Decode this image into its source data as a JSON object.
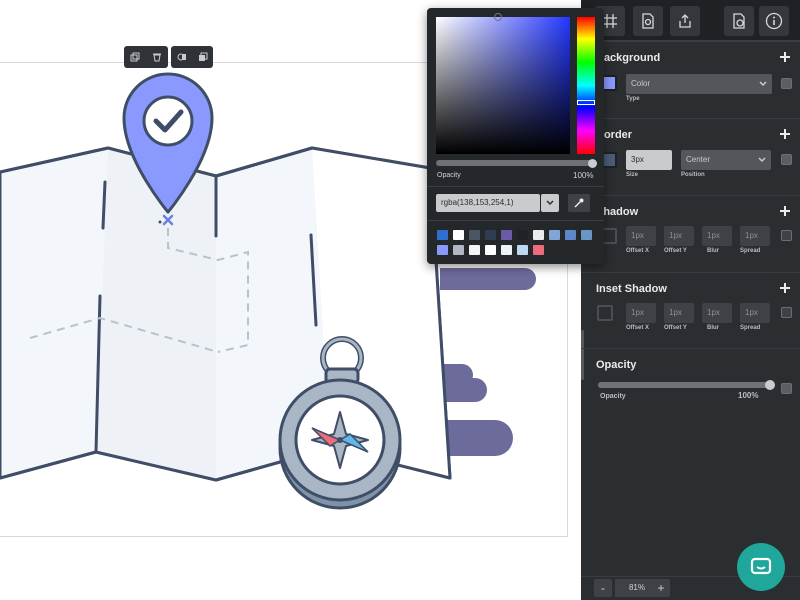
{
  "panel": {
    "background": {
      "title": "Background",
      "type_value": "Color",
      "type_label": "Type",
      "swatch_color": "#8a99fe"
    },
    "border": {
      "title": "Border",
      "size_value": "3px",
      "size_label": "Size",
      "position_value": "Center",
      "position_label": "Position",
      "swatch_color": "#4d5d77"
    },
    "shadow": {
      "title": "Shadow",
      "values": [
        "1px",
        "1px",
        "1px",
        "1px"
      ],
      "labels": [
        "Offset X",
        "Offset Y",
        "Blur",
        "Spread"
      ]
    },
    "inset_shadow": {
      "title": "Inset Shadow",
      "values": [
        "1px",
        "1px",
        "1px",
        "1px"
      ],
      "labels": [
        "Offset X",
        "Offset Y",
        "Blur",
        "Spread"
      ]
    },
    "opacity": {
      "title": "Opacity",
      "label": "Opacity",
      "value": "100%",
      "level": 1.0
    },
    "zoom": {
      "minus": "-",
      "value": "81%",
      "plus": "+"
    },
    "toolbar_icons": [
      "grid-icon",
      "page-settings-icon",
      "share-icon",
      "page-info-icon",
      "info-icon"
    ]
  },
  "picker": {
    "opacity_label": "Opacity",
    "opacity_value": "100%",
    "opacity_level": 1.0,
    "rgba_value": "rgba(138,153,254,1)",
    "hue_color": "#2437ff",
    "swatches_row1": [
      "#2f6fd0",
      "#ffffff",
      "#4a5663",
      "#2e3d52",
      "#6b5aa8",
      "#1f2226",
      "#e9ecef",
      "#7fa6d6",
      "#5b88c8",
      "#6b95c2"
    ],
    "swatches_row2": [
      "#8a99fe",
      "#b0b8c4",
      "#f4f6f8",
      "#ffffff",
      "#eef3f8",
      "#bcd9f3",
      "#f06a7d"
    ]
  },
  "colors": {
    "accent": "#8a99fe",
    "map_stroke": "#3f4e66",
    "cloud": "#6d6a9c",
    "panel_bg": "#2b2e31",
    "chat": "#1ea79a"
  }
}
